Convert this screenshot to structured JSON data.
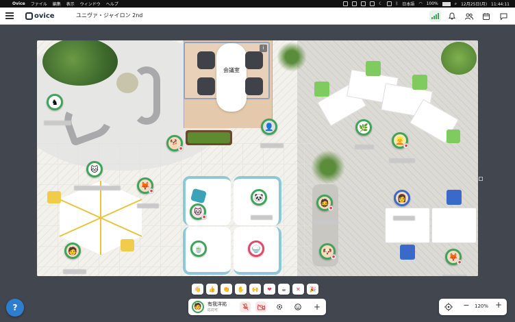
{
  "menubar": {
    "app_name": "Ovice",
    "menus": [
      "ファイル",
      "編集",
      "表示",
      "ウィンドウ",
      "ヘルプ"
    ],
    "input_mode": "日本語",
    "battery": "100%",
    "clock": "12月25日(月)　11:44:11"
  },
  "appbar": {
    "logo_text": "ovice",
    "space_name": "ユニヴァ・ジャイロン 2nd"
  },
  "map": {
    "meeting_room_label": "会議室",
    "meeting_room_badge": "i"
  },
  "reactions": [
    "👋",
    "👍",
    "👏",
    "✋",
    "🙌",
    "❤",
    "☕",
    "✕",
    "🎉"
  ],
  "userbar": {
    "name": "有我洋祐",
    "status": "応対可"
  },
  "zoom": {
    "level": "120%",
    "minus": "−",
    "plus": "+"
  },
  "help_fab": "?",
  "colors": {
    "accent_green": "#3fa45a",
    "map_bg": "#f3f1ec",
    "app_bg": "#42464f",
    "danger": "#e0474c"
  }
}
